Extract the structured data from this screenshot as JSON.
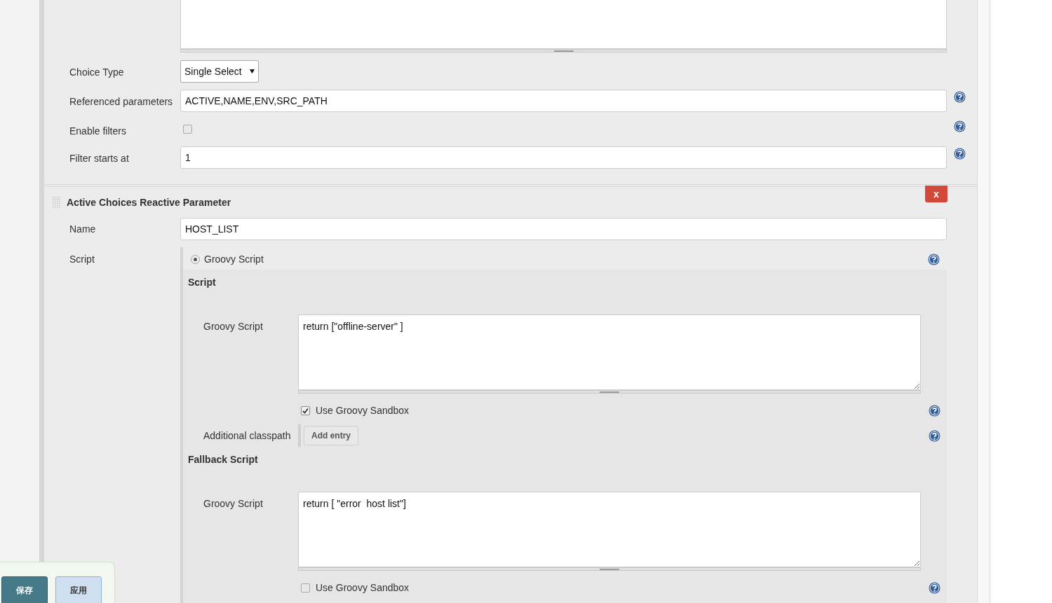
{
  "top_section": {
    "fields": [
      {
        "kind": "select",
        "label": "Choice Type",
        "value": "Single Select",
        "help": false
      },
      {
        "kind": "text",
        "label": "Referenced parameters",
        "value": "ACTIVE,NAME,ENV,SRC_PATH",
        "help": true
      },
      {
        "kind": "checkbox",
        "label": "Enable filters",
        "checked": false,
        "help": true
      },
      {
        "kind": "text",
        "label": "Filter starts at",
        "value": "1",
        "help": true
      }
    ]
  },
  "parameter": {
    "title": "Active Choices Reactive Parameter",
    "delete_label": "x",
    "name_label": "Name",
    "name_value": "HOST_LIST",
    "script_label": "Script",
    "script_option": {
      "label": "Groovy Script",
      "selected": true
    },
    "sections": [
      {
        "title": "Script",
        "script_label": "Groovy Script",
        "script": "return [\"offline-server\" ]",
        "sandbox": {
          "label": "Use Groovy Sandbox",
          "checked": true
        },
        "classpath": {
          "label": "Additional classpath",
          "button": "Add entry"
        }
      },
      {
        "title": "Fallback Script",
        "script_label": "Groovy Script",
        "script": "return [ \"error  host list\"]",
        "sandbox": {
          "label": "Use Groovy Sandbox",
          "checked": false
        }
      }
    ]
  },
  "footer_buttons": [
    {
      "label": "保存",
      "kind": "primary"
    },
    {
      "label": "应用",
      "kind": "secondary"
    }
  ]
}
